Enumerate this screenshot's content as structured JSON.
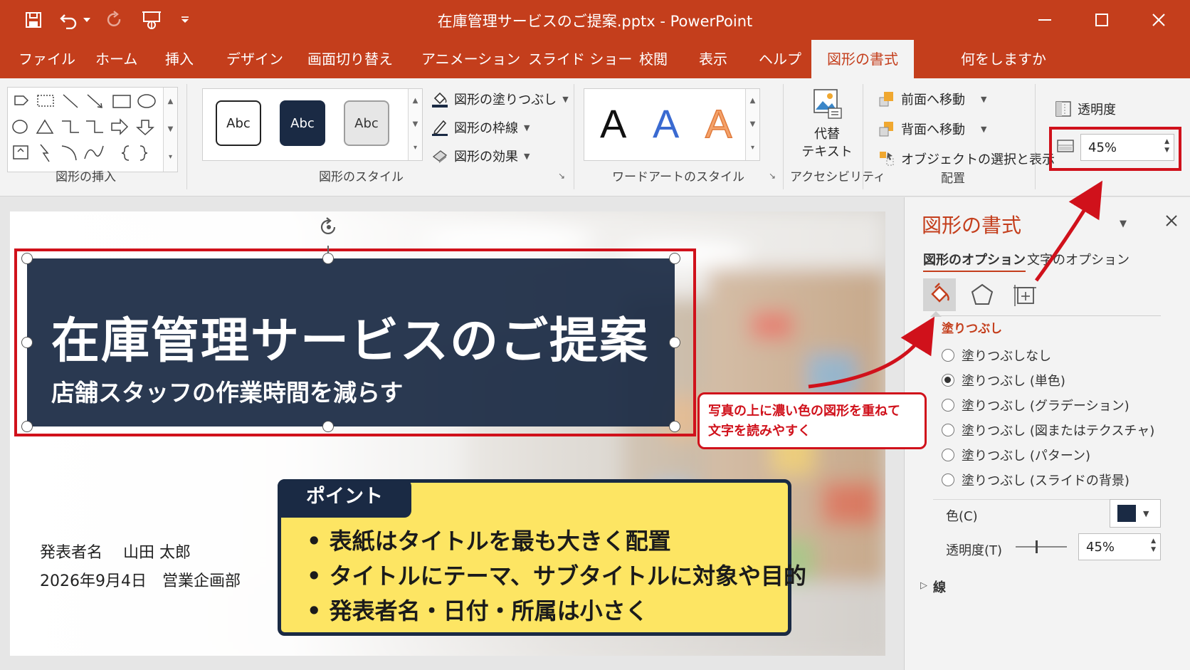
{
  "window": {
    "title": "在庫管理サービスのご提案.pptx  -  PowerPoint"
  },
  "quick_access": {
    "icons": [
      "save-icon",
      "undo-icon",
      "redo-icon",
      "start-from-beginning-icon",
      "customize-icon"
    ]
  },
  "menu": {
    "tabs": [
      "ファイル",
      "ホーム",
      "挿入",
      "デザイン",
      "画面切り替え",
      "アニメーション",
      "スライド ショー",
      "校閲",
      "表示",
      "ヘルプ",
      "図形の書式"
    ],
    "active_tab": "図形の書式",
    "tell_me": "何をしますか"
  },
  "ribbon": {
    "insert_shapes": {
      "label": "図形の挿入"
    },
    "shape_styles": {
      "label": "図形のスタイル",
      "style_samples": [
        "Abc",
        "Abc",
        "Abc"
      ],
      "fill": "図形の塗りつぶし",
      "outline": "図形の枠線",
      "effects": "図形の効果"
    },
    "wordart": {
      "label": "ワードアートのスタイル",
      "samples": [
        "A",
        "A",
        "A"
      ]
    },
    "accessibility": {
      "alt_text_line1": "代替",
      "alt_text_line2": "テキスト",
      "label": "アクセシビリティ"
    },
    "arrange": {
      "bring_forward": "前面へ移動",
      "send_backward": "背面へ移動",
      "selection_pane": "オブジェクトの選択と表示",
      "label": "配置"
    },
    "transparency": {
      "label": "透明度",
      "value": "45%"
    }
  },
  "slide": {
    "title": "在庫管理サービスのご提案",
    "subtitle": "店舗スタッフの作業時間を減らす",
    "presenter_line1": "発表者名　 山田 太郎",
    "presenter_line2": "2026年9月4日　営業企画部",
    "point": {
      "tag": "ポイント",
      "items": [
        "• 表紙はタイトルを最も大きく配置",
        "• タイトルにテーマ、サブタイトルに対象や目的",
        "• 発表者名・日付・所属は小さく"
      ]
    }
  },
  "callout": {
    "line1": "写真の上に濃い色の図形を重ねて",
    "line2": "文字を読みやすく"
  },
  "format_pane": {
    "title": "図形の書式",
    "tabs": [
      "図形のオプション",
      "文字のオプション"
    ],
    "section_fill": "塗りつぶし",
    "fill_options": [
      "塗りつぶしなし",
      "塗りつぶし (単色)",
      "塗りつぶし (グラデーション)",
      "塗りつぶし (図またはテクスチャ)",
      "塗りつぶし (パターン)",
      "塗りつぶし (スライドの背景)"
    ],
    "selected_fill_index": 1,
    "color_label": "色(C)",
    "color_value": "#1a2a44",
    "transparency_label": "透明度(T)",
    "transparency_value": "45%",
    "line_section": "線"
  },
  "colors": {
    "accent": "#c43e1c",
    "highlight_red": "#d0111b",
    "title_box": "#1a2a44",
    "point_box": "#fde563"
  }
}
